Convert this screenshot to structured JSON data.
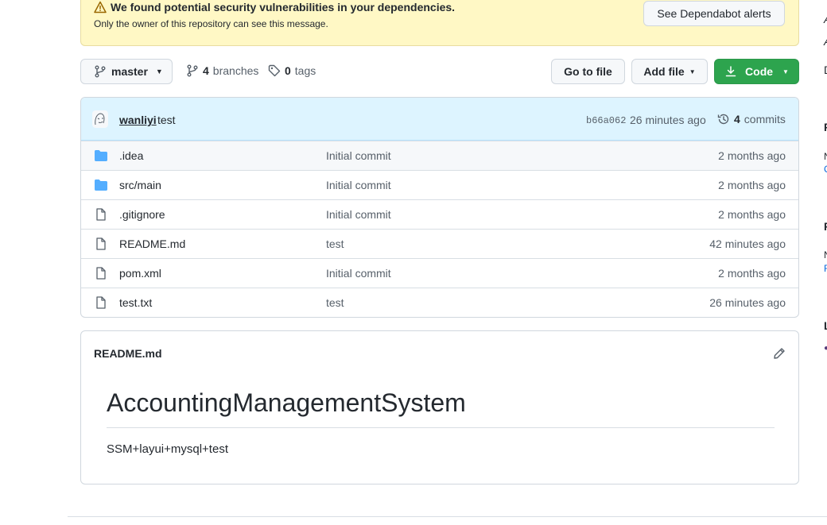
{
  "security_flash": {
    "title": "We found potential security vulnerabilities in your dependencies.",
    "subtitle": "Only the owner of this repository can see this message.",
    "button_label": "See Dependabot alerts"
  },
  "branch_selector": {
    "label": "master"
  },
  "branches": {
    "count": "4",
    "label": "branches"
  },
  "tags": {
    "count": "0",
    "label": "tags"
  },
  "actions": {
    "goto_file": "Go to file",
    "add_file": "Add file",
    "code": "Code"
  },
  "latest_commit": {
    "author": "wanliyi",
    "message": "test",
    "sha": "b66a062",
    "time": "26 minutes ago",
    "count": "4",
    "count_label": "commits"
  },
  "files": [
    {
      "type": "folder",
      "name": ".idea",
      "message": "Initial commit",
      "time": "2 months ago"
    },
    {
      "type": "folder",
      "name": "src/main",
      "message": "Initial commit",
      "time": "2 months ago"
    },
    {
      "type": "file",
      "name": ".gitignore",
      "message": "Initial commit",
      "time": "2 months ago"
    },
    {
      "type": "file",
      "name": "README.md",
      "message": "test",
      "time": "42 minutes ago"
    },
    {
      "type": "file",
      "name": "pom.xml",
      "message": "Initial commit",
      "time": "2 months ago"
    },
    {
      "type": "file",
      "name": "test.txt",
      "message": "test",
      "time": "26 minutes ago"
    }
  ],
  "readme": {
    "filename": "README.md",
    "heading": "AccountingManagementSystem",
    "body": "SSM+layui+mysql+test"
  },
  "right_edge_fragments": [
    "A",
    "A",
    "D",
    "F",
    "N",
    "C",
    "F",
    "N",
    "F",
    "L"
  ],
  "colors": {
    "accent_green": "#2da44e",
    "flash_bg": "#fff8c5",
    "commit_bar_bg": "#ddf4ff",
    "folder_icon": "#54aeff"
  }
}
